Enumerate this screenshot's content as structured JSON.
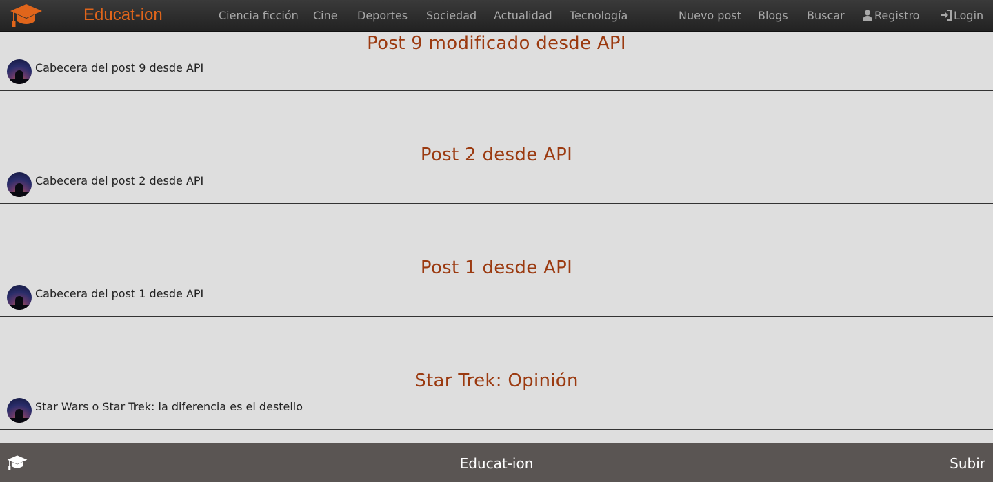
{
  "brand": {
    "name": "Educat-ion",
    "icon": "graduation-cap-icon",
    "color": "#e0651b"
  },
  "nav": {
    "categories": [
      "Ciencia ficción",
      "Cine",
      "Deportes",
      "Sociedad",
      "Actualidad",
      "Tecnología"
    ],
    "new_post": "Nuevo post",
    "blogs": "Blogs",
    "search": "Buscar",
    "register": "Registro",
    "login": "Login"
  },
  "posts": [
    {
      "title": "Post 9 modificado desde API",
      "summary": "Cabecera del post 9 desde API"
    },
    {
      "title": "Post 2 desde API",
      "summary": "Cabecera del post 2 desde API"
    },
    {
      "title": "Post 1 desde API",
      "summary": "Cabecera del post 1 desde API"
    },
    {
      "title": "Star Trek: Opinión",
      "summary": "Star Wars o Star Trek: la diferencia es el destello"
    }
  ],
  "footer": {
    "brand": "Educat-ion",
    "top_link": "Subir"
  },
  "colors": {
    "title": "#9b3a10",
    "footer_bg": "#5a5553",
    "page_bg": "#dedede"
  }
}
